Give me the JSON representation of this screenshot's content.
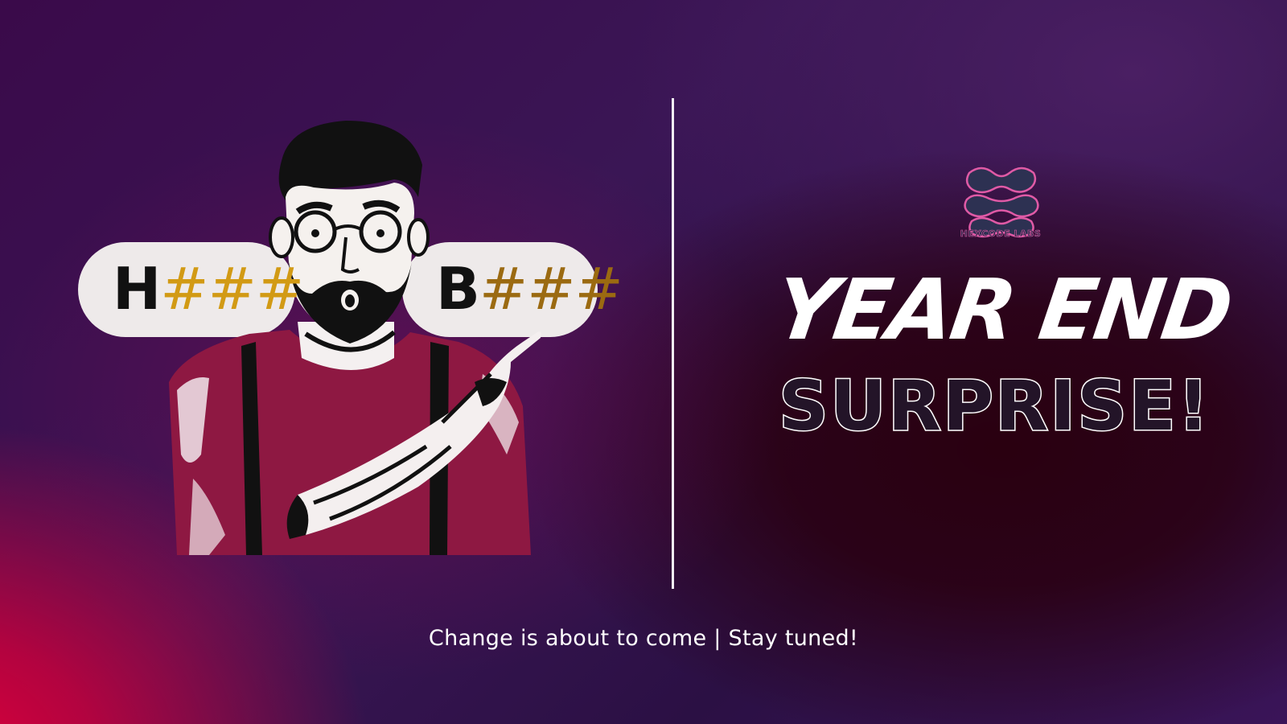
{
  "pills": {
    "left": {
      "letter": "H",
      "hashes": "###"
    },
    "right": {
      "letter": "B",
      "hashes": "###"
    }
  },
  "logo": {
    "icon": "hexcode-labs-logo-icon",
    "text": "HEXCODE LABS"
  },
  "headline": {
    "line1": "YEAR END",
    "line2": "SURPRISE!"
  },
  "tagline": "Change is about to come | Stay tuned!",
  "colors": {
    "gold": "#d29a14",
    "brown": "#9b6a11",
    "pill": "#eeeaea",
    "accent_red": "#e0003a",
    "purple": "#3a1655"
  }
}
